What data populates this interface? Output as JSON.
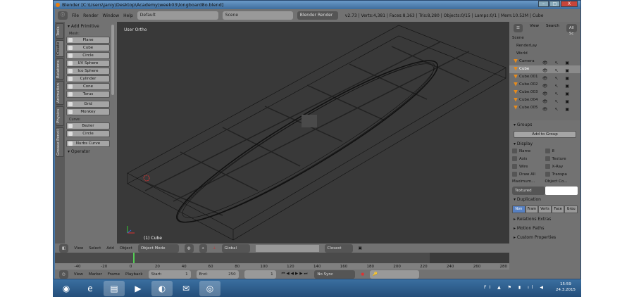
{
  "window": {
    "title": "Blender [C:\\Users\\janiy\\Desktop\\Academy\\week03\\longboard8o.blend]",
    "min": "–",
    "max": "□",
    "close": "X"
  },
  "header": {
    "menus": [
      "File",
      "Render",
      "Window",
      "Help"
    ],
    "layout": "Default",
    "scene": "Scene",
    "engine": "Blender Render",
    "stats": "v2.73 | Verts:4,381 | Faces:8,163 | Tris:8,280 | Objects:0/15 | Lamps:0/1 | Mem:10.52M | Cube"
  },
  "toolshelf": {
    "tabs": [
      "Tools",
      "Create",
      "Relations",
      "Animation",
      "Physics",
      "Grease Pencil"
    ],
    "panel": "Add Primitive",
    "mesh_label": "Mesh:",
    "mesh": [
      "Plane",
      "Cube",
      "Circle",
      "UV Sphere",
      "Ico Sphere",
      "Cylinder",
      "Cone",
      "Torus"
    ],
    "mesh2": [
      "Grid",
      "Monkey"
    ],
    "curve_label": "Curve:",
    "curve": [
      "Bezier",
      "Circle"
    ],
    "curve2": [
      "Nurbs Curve"
    ],
    "operator": "Operator"
  },
  "viewport": {
    "label": "User Ortho",
    "object": "(1) Cube"
  },
  "outliner": {
    "menus": [
      "View",
      "Search",
      "All Sc"
    ],
    "items": [
      {
        "name": "Scene"
      },
      {
        "name": "RenderLay"
      },
      {
        "name": "World"
      },
      {
        "name": "Camera"
      },
      {
        "name": "Cube"
      },
      {
        "name": "Cube.001"
      },
      {
        "name": "Cube.002"
      },
      {
        "name": "Cube.003"
      },
      {
        "name": "Cube.004"
      },
      {
        "name": "Cube.005"
      }
    ]
  },
  "properties": {
    "groups": "Groups",
    "add_to_group": "Add to Group",
    "display": "Display",
    "name": "Name",
    "axis": "Axis",
    "wire": "Wire",
    "draw_all": "Draw All",
    "texture": "Texture",
    "xray": "X-Ray",
    "transp": "Transpa",
    "num": "8",
    "maximum": "Maximum...",
    "object_color": "Object Co...",
    "textured": "Textured",
    "duplication": "Duplication",
    "dup_options": [
      "Non",
      "Fram",
      "Verts",
      "Face",
      "Grou"
    ],
    "collapsed": [
      "Relations Extras",
      "Motion Paths",
      "Custom Properties"
    ]
  },
  "view3d_header": {
    "menus": [
      "View",
      "Select",
      "Add",
      "Object"
    ],
    "mode": "Object Mode",
    "orientation": "Global",
    "snap": "Closest"
  },
  "timeline": {
    "ticks": [
      "-40",
      "-20",
      "0",
      "20",
      "40",
      "60",
      "80",
      "100",
      "120",
      "140",
      "160",
      "180",
      "200",
      "220",
      "240",
      "260",
      "280"
    ],
    "current_frame": 1
  },
  "timeline_header": {
    "menus": [
      "View",
      "Marker",
      "Frame",
      "Playback"
    ],
    "start_label": "Start:",
    "start": "1",
    "end_label": "End:",
    "end": "250",
    "frame": "1",
    "sync": "No Sync"
  },
  "taskbar": {
    "lang": "FI",
    "time": "15:59",
    "date": "24.3.2015"
  }
}
